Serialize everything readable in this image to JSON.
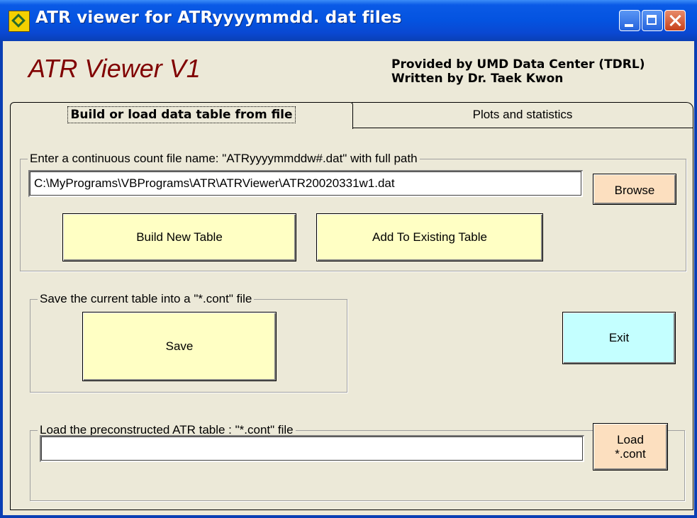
{
  "window": {
    "title": "ATR viewer for ATRyyyymmdd. dat files",
    "controls": [
      "minimize",
      "maximize",
      "close"
    ]
  },
  "header": {
    "app_title": "ATR Viewer V1",
    "provided_by": "Provided by UMD Data Center (TDRL)",
    "written_by": "Written by Dr. Taek Kwon"
  },
  "tabs": [
    {
      "label": "Build or load data table from file",
      "active": true
    },
    {
      "label": "Plots and statistics",
      "active": false
    }
  ],
  "build_group": {
    "legend": "Enter a continuous count file name: \"ATRyyyymmddw#.dat\" with full path",
    "file_path": "C:\\MyPrograms\\VBPrograms\\ATR\\ATRViewer\\ATR20020331w1.dat",
    "browse_label": "Browse",
    "build_label": "Build New Table",
    "add_label": "Add To Existing Table"
  },
  "save_group": {
    "legend": "Save the current table into a \"*.cont\" file",
    "save_label": "Save"
  },
  "exit_label": "Exit",
  "load_group": {
    "legend": "Load the preconstructed ATR table : \"*.cont\" file",
    "file_path": "",
    "load_label_line1": "Load",
    "load_label_line2": "*.cont"
  },
  "colors": {
    "title_bar": "#0453e0",
    "app_title": "#800000",
    "button_yellow": "#ffffc4",
    "button_peach": "#fcdfbf",
    "button_cyan": "#c4ffff",
    "window_bg": "#ece9d8"
  }
}
